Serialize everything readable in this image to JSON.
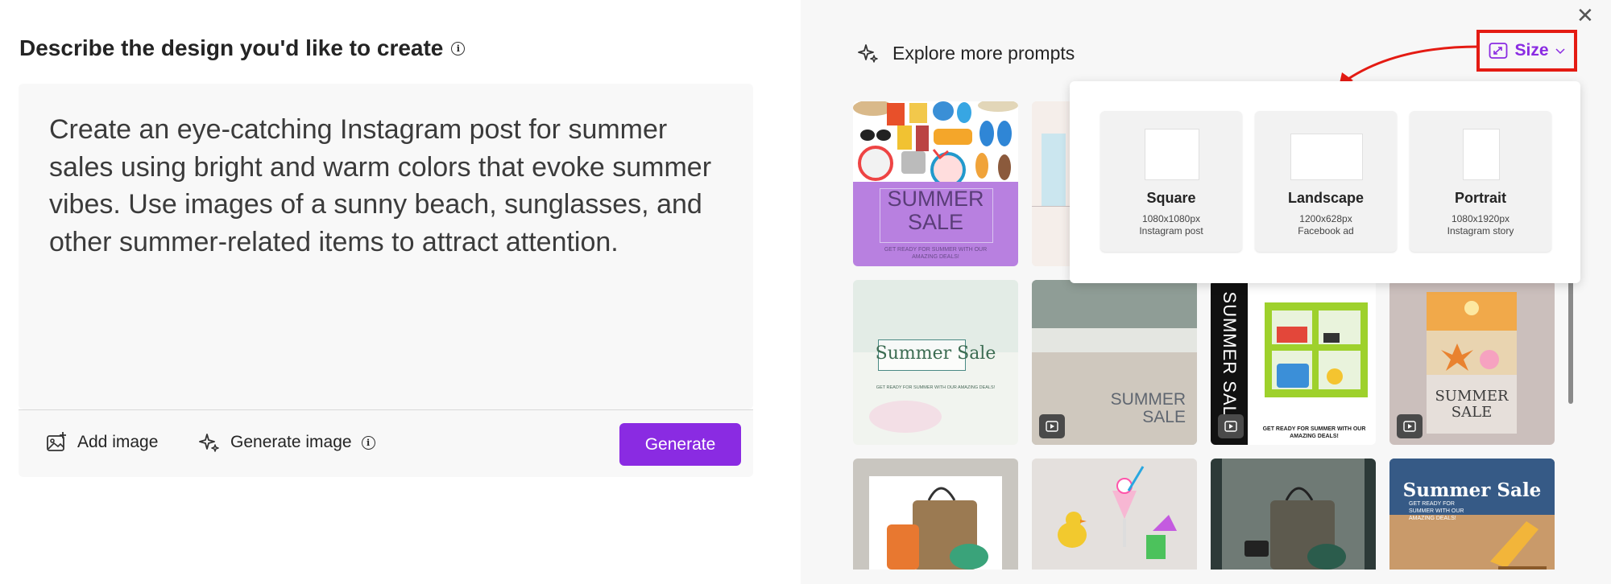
{
  "left": {
    "heading": "Describe the design you'd like to create",
    "prompt_text": "Create an eye-catching Instagram post for summer sales using bright and warm colors that evoke summer vibes. Use images of a sunny beach, sunglasses, and other summer-related items to attract attention.",
    "add_image_label": "Add image",
    "generate_image_label": "Generate image",
    "generate_button": "Generate"
  },
  "right": {
    "explore_label": "Explore more prompts",
    "size_label": "Size"
  },
  "size_options": [
    {
      "title": "Square",
      "dims": "1080x1080px",
      "usage": "Instagram post"
    },
    {
      "title": "Landscape",
      "dims": "1200x628px",
      "usage": "Facebook ad"
    },
    {
      "title": "Portrait",
      "dims": "1080x1920px",
      "usage": "Instagram story"
    }
  ],
  "thumbnails": {
    "t1_title_line1": "SUMMER",
    "t1_title_line2": "SALE",
    "t1_subtitle": "GET READY FOR SUMMER WITH OUR AMAZING DEALS!",
    "t3_title": "Summer Sale",
    "t3_subtitle": "GET READY FOR SUMMER WITH OUR AMAZING DEALS!",
    "t4_title_line1": "SUMMER",
    "t4_title_line2": "SALE",
    "t5_vertical": "SUMMER SALE",
    "t5_subtitle": "GET READY FOR SUMMER WITH OUR AMAZING DEALS!",
    "t6_title_line1": "SUMMER",
    "t6_title_line2": "SALE",
    "t10_title": "Summer Sale",
    "t10_subtitle": "GET READY FOR SUMMER WITH OUR AMAZING DEALS!"
  },
  "colors": {
    "accent": "#8a2be2",
    "highlight": "#e41b13"
  }
}
